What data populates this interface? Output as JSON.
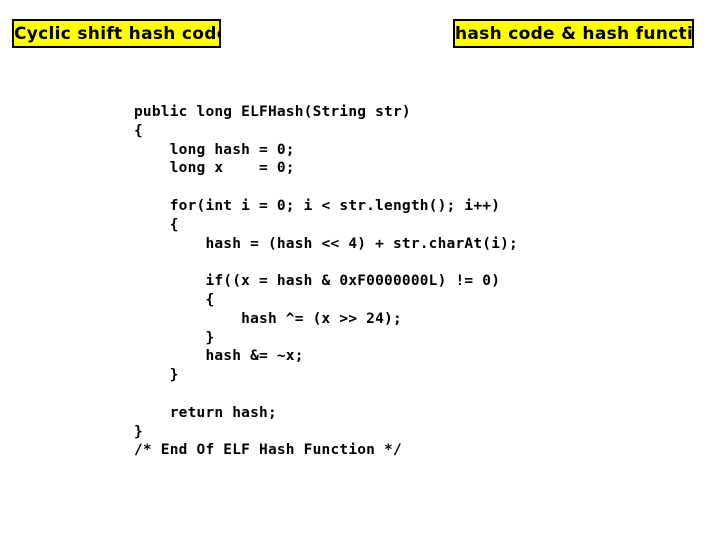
{
  "slide": {
    "background_color": "#FFFFFF",
    "banner_left": {
      "label": "Cyclic shift hash codes",
      "fill_color": "#FFFF00",
      "border_color": "#000000",
      "text_color": "#000000"
    },
    "banner_right": {
      "label": "hash code & hash function",
      "fill_color": "#FFFF00",
      "border_color": "#000000",
      "text_color": "#000000"
    },
    "code": {
      "language": "java",
      "text_color": "#000000",
      "lines": [
        "public long ELFHash(String str)",
        "{",
        "    long hash = 0;",
        "    long x    = 0;",
        "",
        "    for(int i = 0; i < str.length(); i++)",
        "    {",
        "        hash = (hash << 4) + str.charAt(i);",
        "",
        "        if((x = hash & 0xF0000000L) != 0)",
        "        {",
        "            hash ^= (x >> 24);",
        "        }",
        "        hash &= ~x;",
        "    }",
        "",
        "    return hash;",
        "}",
        "/* End Of ELF Hash Function */"
      ]
    }
  }
}
